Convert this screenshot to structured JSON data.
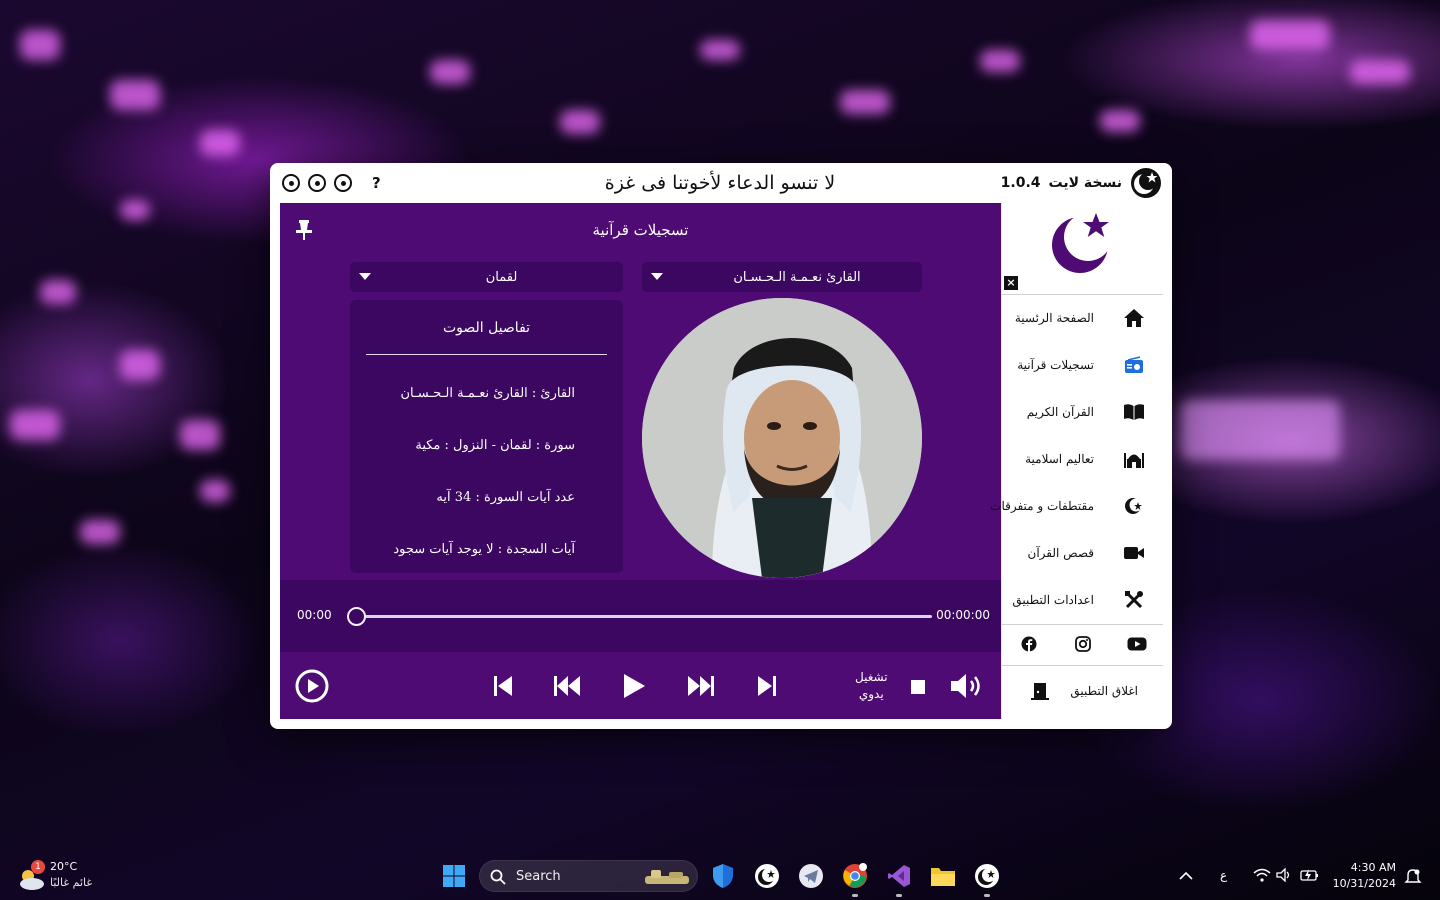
{
  "window": {
    "title_center": "لا تنسو الدعاء لأخوتنا فى غزة",
    "app_name": "نسخة لايت",
    "version": "1.0.4",
    "help_label": "?"
  },
  "main": {
    "title": "تسجيلات قرآنية",
    "reciter_select": {
      "value": "القارئ نعـمـة الـحـسـان"
    },
    "surah_select": {
      "value": "لقمان"
    },
    "details": {
      "title": "تفاصيل الصوت",
      "reciter_line": "القارئ : القارئ نعـمـة الـحـسـان",
      "surah_line": "سورة  :  لقمان  -  النزول  :  مكية",
      "ayah_count_line": "عدد آيات السورة :  34  آيه",
      "sajda_line": "آيات السجدة  :  لا يوجد آيات سجود"
    },
    "player": {
      "time_elapsed": "00:00",
      "time_total": "00:00:00",
      "progress": 0,
      "mode_line1": "تشغيل",
      "mode_line2": "يدوي"
    }
  },
  "sidebar": {
    "close_label": "×",
    "items": [
      {
        "label": "الصفحة الرئسية",
        "icon": "home-icon"
      },
      {
        "label": "تسجيلات قرآنية",
        "icon": "radio-icon"
      },
      {
        "label": "القرآن الكريم",
        "icon": "book-icon"
      },
      {
        "label": "تعاليم اسلامية",
        "icon": "mosque-icon"
      },
      {
        "label": "مقتطفات و متفرقات",
        "icon": "crescent-star-icon"
      },
      {
        "label": "قصص القرآن",
        "icon": "video-camera-icon"
      },
      {
        "label": "اعدادات التطبيق",
        "icon": "tools-icon"
      }
    ],
    "social": [
      "facebook-icon",
      "instagram-icon",
      "youtube-icon"
    ],
    "exit_label": "اغلاق التطبيق"
  },
  "taskbar": {
    "weather_temp": "20°C",
    "weather_condition": "غائم غالبًا",
    "weather_badge": "1",
    "search_placeholder": "Search",
    "language": "ع",
    "time": "4:30 AM",
    "date": "10/31/2024"
  },
  "colors": {
    "panel": "#4e0b73",
    "panel_dark": "#3b0760",
    "accent_blue": "#1e6fd9"
  }
}
